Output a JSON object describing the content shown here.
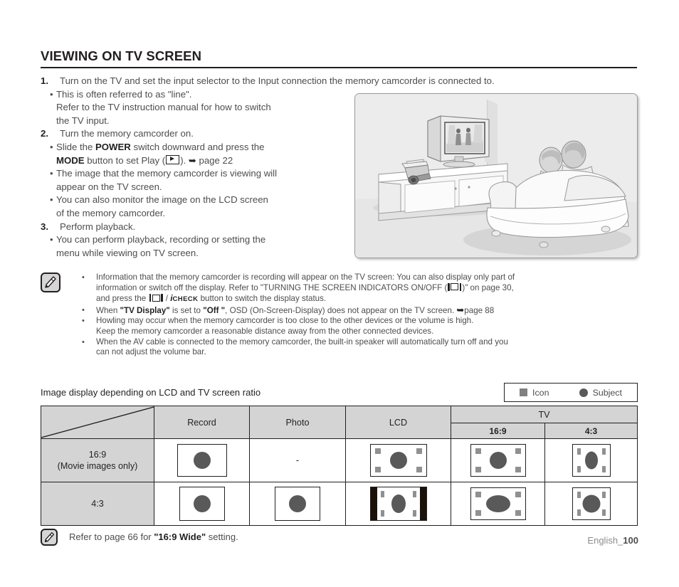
{
  "document": {
    "section_title": "VIEWING ON TV SCREEN",
    "page_label_prefix": "English_",
    "page_number": "100"
  },
  "steps": [
    {
      "number": "1.",
      "text": "Turn on the TV and set the input selector to the Input connection the memory camcorder is connected to.",
      "bullets": [
        "This is often referred to as \"line\".\nRefer to the TV instruction manual for how to switch the TV input."
      ]
    },
    {
      "number": "2.",
      "text": "Turn the memory camcorder on.",
      "bullets": [
        "Slide the POWER switch downward and press the MODE button to set Play ( ▶ ). ➥ page 22",
        "The image that the memory camcorder is viewing will appear on the TV screen.",
        "You can also monitor the image on the LCD screen of the memory camcorder."
      ]
    },
    {
      "number": "3.",
      "text": "Perform playback.",
      "bullets": [
        "You can perform playback, recording or setting the menu while viewing on TV screen."
      ]
    }
  ],
  "step_fragments": {
    "s1_bullet1_a": "This is often referred to as \"line\".",
    "s1_bullet1_b": "Refer to the TV instruction manual for how to switch",
    "s1_bullet1_c": "the TV input.",
    "s2_b1_pre": "Slide the ",
    "s2_b1_power": "POWER",
    "s2_b1_mid": " switch downward and press the",
    "s2_b1_mode": "MODE",
    "s2_b1_post": " button to set Play (",
    "s2_b1_close": "). ",
    "s2_b1_page": "page 22",
    "s2_b2_a": "The image that the memory camcorder is viewing will",
    "s2_b2_b": "appear on the TV screen.",
    "s2_b3_a": "You can also monitor the image on the LCD screen",
    "s2_b3_b": "of the memory camcorder.",
    "s3_b1_a": "You can perform playback, recording or setting the",
    "s3_b1_b": "menu while viewing on TV screen."
  },
  "notes": {
    "items": [
      {
        "line1": "Information that the memory camcorder is recording will appear on the TV screen: You can also display only part of",
        "line2_a": "information or switch off the display. Refer to \"TURNING THE SCREEN INDICATORS ON/OFF (",
        "line2_b": ")\" on page 30,",
        "line3_a": "and press the",
        "line3_slash": "/",
        "line3_i": "i",
        "line3_check": "CHECK",
        "line3_b": "button to switch the display status."
      },
      {
        "pre": "When ",
        "b1": "\"TV Display\"",
        "mid": " is set to ",
        "b2": "\"Off \"",
        "post": ", OSD (On-Screen-Display) does not appear on the TV screen. ",
        "link": "page 88"
      },
      {
        "line1": "Howling may occur when the memory camcorder is too close to the other devices or the volume is high.",
        "line2": "Keep the memory camcorder a reasonable distance away from the other connected devices."
      },
      {
        "line1": "When the AV cable is connected to the memory camcorder, the built-in speaker will automatically turn off and you",
        "line2": "can not adjust the volume bar."
      }
    ]
  },
  "table_section": {
    "caption": "Image display depending on LCD and TV screen ratio",
    "legend": {
      "icon_label": "Icon",
      "subject_label": "Subject",
      "icon_color": "#808080",
      "subject_color": "#595959"
    },
    "headers": {
      "corner": "",
      "record": "Record",
      "photo": "Photo",
      "lcd": "LCD",
      "tv": "TV",
      "tv_169": "16:9",
      "tv_43": "4:3"
    },
    "rows": [
      {
        "label_line1": "16:9",
        "label_line2": "(Movie images only)",
        "record": "screen-wide-circle",
        "photo": "-",
        "lcd": "screen-wide-markers",
        "tv_169": "screen-wide-markers",
        "tv_43": "screen-narrow-markers-tall-oval"
      },
      {
        "label_line1": "4:3",
        "label_line2": "",
        "record": "screen-standard-circle",
        "photo": "screen-standard-circle",
        "lcd": "screen-pillarbox-markers",
        "tv_169": "screen-wide-markers-wide-oval",
        "tv_43": "screen-narrow-markers"
      }
    ]
  },
  "footer_note": {
    "pre": "Refer to page 66 for ",
    "bold": "\"16:9 Wide\"",
    "post": " setting."
  },
  "illustration": {
    "alt": "Living room scene: flat TV on a console with a camcorder beside it, two people sitting on a sofa watching",
    "background_color": "#ececec"
  }
}
